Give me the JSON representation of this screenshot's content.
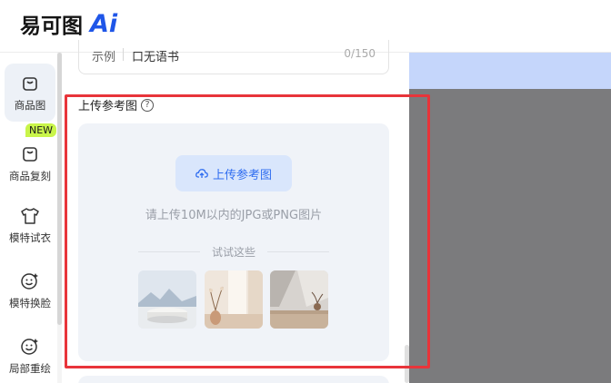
{
  "header": {
    "logo_text": "易可图",
    "logo_ai": "Ai"
  },
  "sidebar": {
    "items": [
      {
        "label": "商品图",
        "icon": "bag-icon",
        "active": true
      },
      {
        "label": "商品复刻",
        "icon": "bag-copy-icon",
        "active": false
      },
      {
        "label": "模特试衣",
        "icon": "shirt-icon",
        "active": false
      },
      {
        "label": "模特换脸",
        "icon": "face-swap-icon",
        "active": false
      },
      {
        "label": "局部重绘",
        "icon": "face-redraw-icon",
        "active": false
      }
    ],
    "new_badge": "NEW"
  },
  "example": {
    "label": "示例",
    "text": "口无语书",
    "counter": "0/150"
  },
  "upload": {
    "title": "上传参考图",
    "help_glyph": "?",
    "button_label": "上传参考图",
    "hint": "请上传10M以内的JPG或PNG图片",
    "try_label": "试试这些",
    "samples": [
      {
        "name": "sample-snow-mountain-podium"
      },
      {
        "name": "sample-window-vase"
      },
      {
        "name": "sample-sunlit-shelf"
      }
    ]
  },
  "colors": {
    "accent": "#2f6df0",
    "highlight": "#e8343a",
    "badge": "#c9f54a",
    "canvas": "#7b7b7d",
    "canvas_top": "#c5d6fb"
  }
}
